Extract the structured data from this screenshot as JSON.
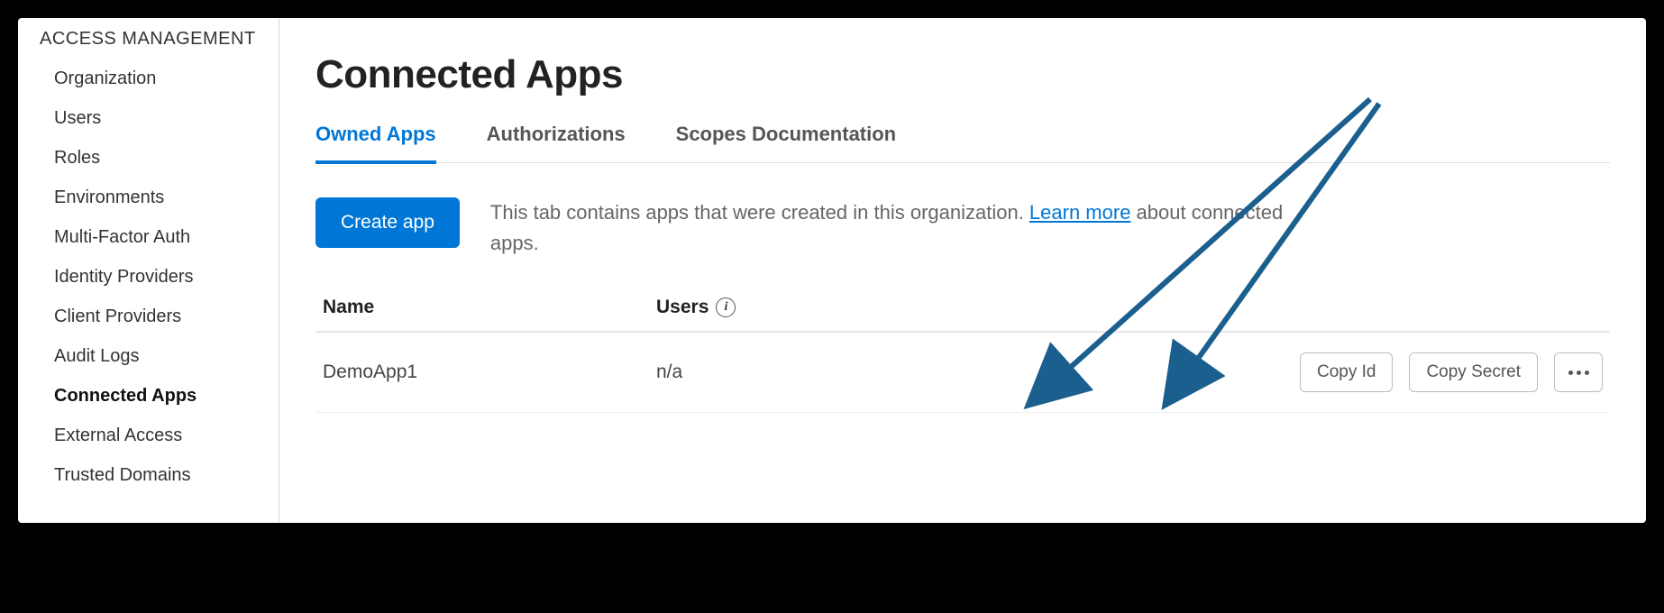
{
  "sidebar": {
    "heading": "ACCESS MANAGEMENT",
    "items": [
      {
        "label": "Organization",
        "active": false
      },
      {
        "label": "Users",
        "active": false
      },
      {
        "label": "Roles",
        "active": false
      },
      {
        "label": "Environments",
        "active": false
      },
      {
        "label": "Multi-Factor Auth",
        "active": false
      },
      {
        "label": "Identity Providers",
        "active": false
      },
      {
        "label": "Client Providers",
        "active": false
      },
      {
        "label": "Audit Logs",
        "active": false
      },
      {
        "label": "Connected Apps",
        "active": true
      },
      {
        "label": "External Access",
        "active": false
      },
      {
        "label": "Trusted Domains",
        "active": false
      }
    ]
  },
  "page": {
    "title": "Connected Apps"
  },
  "tabs": [
    {
      "label": "Owned Apps",
      "active": true
    },
    {
      "label": "Authorizations",
      "active": false
    },
    {
      "label": "Scopes Documentation",
      "active": false
    }
  ],
  "owned": {
    "create_label": "Create app",
    "desc_before": "This tab contains apps that were created in this organization. ",
    "learn_more": "Learn more",
    "desc_after": " about connected apps.",
    "columns": {
      "name": "Name",
      "users": "Users"
    },
    "rows": [
      {
        "name": "DemoApp1",
        "users": "n/a",
        "copy_id": "Copy Id",
        "copy_secret": "Copy Secret"
      }
    ]
  }
}
